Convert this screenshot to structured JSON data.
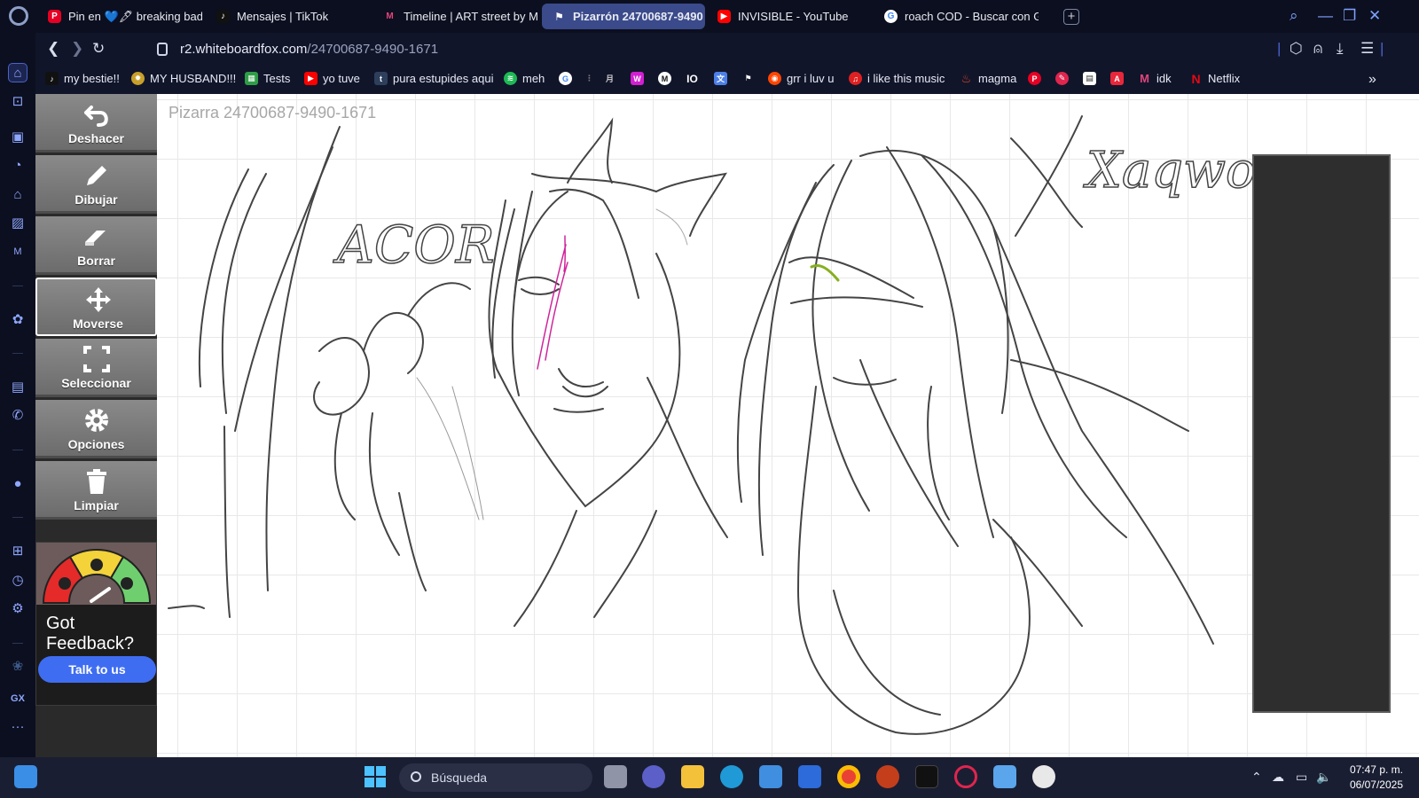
{
  "browser": {
    "tabs": [
      {
        "label": "Pin en 💙🖋 breaking bad",
        "icon": "pinterest-icon",
        "color": "#e60023"
      },
      {
        "label": "Mensajes | TikTok",
        "icon": "tiktok-icon",
        "color": "#111111"
      },
      {
        "label": "Timeline | ART street by M",
        "icon": "artstreet-icon",
        "color": "#d7336f"
      },
      {
        "label": "Pizarrón 24700687-9490",
        "icon": "whiteboard-icon",
        "color": "#2d67f5"
      },
      {
        "label": "INVISIBLE - YouTube",
        "icon": "youtube-icon",
        "color": "#ff0000"
      },
      {
        "label": "roach COD - Buscar con G",
        "icon": "google-icon",
        "color": "#4285f4"
      }
    ],
    "address": {
      "host": "r2.whiteboardfox.com",
      "path": "/24700687-9490-1671"
    },
    "bookmarks": [
      {
        "label": "my bestie!!",
        "icon": "tiktok-icon",
        "color": "#111111"
      },
      {
        "label": "MY HUSBAND!!!",
        "icon": "gear-emoji-icon",
        "color": "#c8a02a"
      },
      {
        "label": "Tests",
        "icon": "sheet-icon",
        "color": "#2e9e46"
      },
      {
        "label": "yo tuve",
        "icon": "youtube-icon",
        "color": "#ff0000"
      },
      {
        "label": "pura estupides aqui",
        "icon": "tumblr-icon",
        "color": "#2e3f5c"
      },
      {
        "label": "meh",
        "icon": "spotify-icon",
        "color": "#1db954"
      },
      {
        "label": "i like this music",
        "icon": "music-icon",
        "color": "#e02020"
      },
      {
        "label": "grr i luv u",
        "icon": "reddit-icon",
        "color": "#ff4500"
      },
      {
        "label": "magma",
        "icon": "flame-icon",
        "color": "#e2462a"
      },
      {
        "label": "idk",
        "icon": "artstreet-icon",
        "color": "#d7336f"
      },
      {
        "label": "Netflix",
        "icon": "netflix-icon",
        "color": "#e50914"
      }
    ]
  },
  "board": {
    "title": "Pizarra 24700687-9490-1671",
    "tools": [
      {
        "label": "Deshacer",
        "icon": "undo-icon"
      },
      {
        "label": "Dibujar",
        "icon": "pencil-icon"
      },
      {
        "label": "Borrar",
        "icon": "eraser-icon"
      },
      {
        "label": "Moverse",
        "icon": "move-icon"
      },
      {
        "label": "Seleccionar",
        "icon": "select-icon"
      },
      {
        "label": "Opciones",
        "icon": "gear-icon"
      },
      {
        "label": "Limpiar",
        "icon": "trash-icon"
      }
    ],
    "selected_tool": "Moverse",
    "feedback": {
      "text": "Got Feedback?",
      "button": "Talk to us"
    },
    "sketch_text": {
      "left": "ACOR",
      "right": "Xaqwo"
    }
  },
  "taskbar": {
    "search_placeholder": "Búsqueda",
    "time": "07:47 p. m.",
    "date": "06/07/2025"
  },
  "colors": {
    "accent": "#3a4a8a",
    "feedback_button": "#3f6df2",
    "ink": "#444444",
    "pink_ink": "#d0249a",
    "green_ink": "#86b01e"
  }
}
